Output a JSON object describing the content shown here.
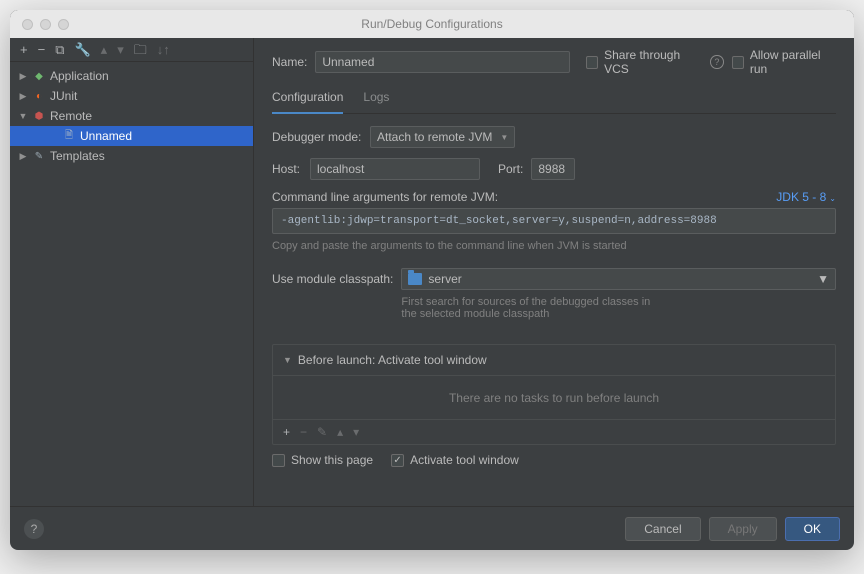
{
  "window": {
    "title": "Run/Debug Configurations"
  },
  "sidebar": {
    "items": [
      {
        "label": "Application",
        "icon": "app",
        "expanded": false
      },
      {
        "label": "JUnit",
        "icon": "junit",
        "expanded": false
      },
      {
        "label": "Remote",
        "icon": "remote",
        "expanded": true,
        "children": [
          {
            "label": "Unnamed",
            "icon": "file",
            "selected": true
          }
        ]
      },
      {
        "label": "Templates",
        "icon": "templates",
        "expanded": false
      }
    ]
  },
  "header": {
    "name_label": "Name:",
    "name_value": "Unnamed",
    "share_label": "Share through VCS",
    "parallel_label": "Allow parallel run"
  },
  "tabs": {
    "config": "Configuration",
    "logs": "Logs"
  },
  "form": {
    "debugger_mode_label": "Debugger mode:",
    "debugger_mode_value": "Attach to remote JVM",
    "host_label": "Host:",
    "host_value": "localhost",
    "port_label": "Port:",
    "port_value": "8988",
    "cmdline_label": "Command line arguments for remote JVM:",
    "jdk_link": "JDK 5 - 8",
    "cmdline_value": "-agentlib:jdwp=transport=dt_socket,server=y,suspend=n,address=8988",
    "cmdline_hint": "Copy and paste the arguments to the command line when JVM is started",
    "module_label": "Use module classpath:",
    "module_value": "server",
    "module_hint": "First search for sources of the debugged classes in the selected module classpath"
  },
  "before_launch": {
    "title": "Before launch: Activate tool window",
    "empty_text": "There are no tasks to run before launch",
    "show_page": "Show this page",
    "activate_window": "Activate tool window"
  },
  "footer": {
    "cancel": "Cancel",
    "apply": "Apply",
    "ok": "OK"
  }
}
